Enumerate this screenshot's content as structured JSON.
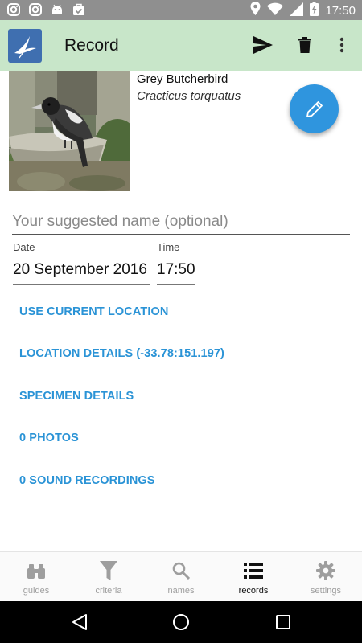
{
  "status_bar": {
    "time": "17:50",
    "left_icons": [
      "instagram-icon",
      "instagram-icon",
      "android-icon",
      "briefcase-check-icon"
    ],
    "right_icons": [
      "location-pin-icon",
      "wifi-icon",
      "signal-icon",
      "battery-charging-icon"
    ]
  },
  "app_bar": {
    "title": "Record",
    "actions": [
      "send-icon",
      "delete-icon",
      "more-vert-icon"
    ],
    "background": "#c8e6c9"
  },
  "species": {
    "common_name": "Grey Butcherbird",
    "scientific_name": "Cracticus torquatus"
  },
  "form": {
    "name_placeholder": "Your suggested name (optional)",
    "name_value": "",
    "date_label": "Date",
    "date_value": "20 September 2016",
    "time_label": "Time",
    "time_value": "17:50"
  },
  "links": {
    "use_current_location": "USE CURRENT LOCATION",
    "location_details": "LOCATION DETAILS (-33.78:151.197)",
    "specimen_details": "SPECIMEN DETAILS",
    "photos": "0 PHOTOS",
    "sound_recordings": "0 SOUND RECORDINGS"
  },
  "bottom_nav": {
    "items": [
      {
        "label": "guides",
        "icon": "binoculars-icon",
        "active": false
      },
      {
        "label": "criteria",
        "icon": "filter-icon",
        "active": false
      },
      {
        "label": "names",
        "icon": "search-icon",
        "active": false
      },
      {
        "label": "records",
        "icon": "list-icon",
        "active": true
      },
      {
        "label": "settings",
        "icon": "gear-icon",
        "active": false
      }
    ]
  },
  "colors": {
    "accent": "#2a93d6",
    "fab": "#2f95de",
    "status_bar": "#8f8f8f"
  }
}
